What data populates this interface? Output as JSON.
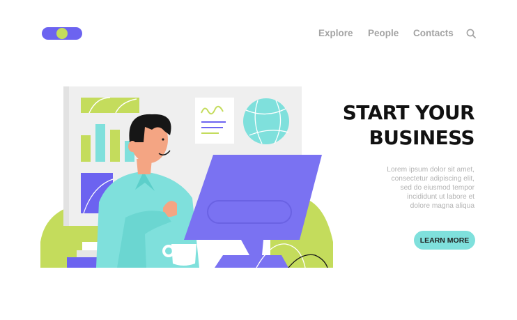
{
  "header": {
    "logo": {
      "name": "logo",
      "colors": [
        "#6c63f0",
        "#c4dc5c"
      ]
    },
    "nav": [
      "Explore",
      "People",
      "Contacts"
    ],
    "search_icon": "search-icon"
  },
  "hero": {
    "headline": [
      "START YOUR",
      "BUSINESS"
    ],
    "body": [
      "Lorem ipsum dolor sit amet,",
      "consectetur adipiscing elit,",
      "sed do eiusmod tempor",
      "incididunt ut labore et",
      "dolore magna aliqua"
    ],
    "cta_label": "LEARN MORE"
  },
  "colors": {
    "accent": "#7fe0dc",
    "purple": "#6c63f0",
    "lime": "#c4dc5c",
    "headline": "#111111",
    "muted": "#b3b3b3"
  }
}
